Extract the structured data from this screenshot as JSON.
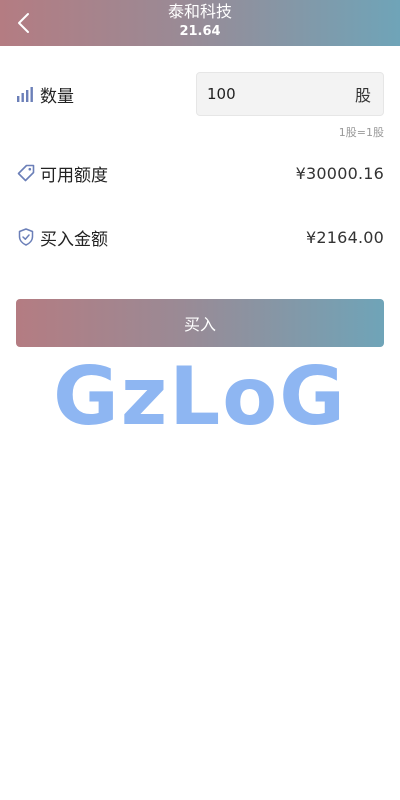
{
  "header": {
    "title": "泰和科技",
    "price": "21.64"
  },
  "quantity": {
    "label": "数量",
    "value": "100",
    "unit": "股",
    "hint": "1股=1股"
  },
  "available": {
    "label": "可用额度",
    "value": "¥30000.16"
  },
  "amount": {
    "label": "买入金额",
    "value": "¥2164.00"
  },
  "buy_button": {
    "label": "买入"
  },
  "watermark": {
    "text": "GzLoG"
  },
  "colors": {
    "gradient_start": "#b47c82",
    "gradient_end": "#6fa4b8",
    "icon": "#6b7fb8",
    "watermark": "#8eb6f2"
  },
  "icons": {
    "back": "chevron-left-icon",
    "quantity": "signal-bars-icon",
    "available": "tag-icon",
    "amount": "shield-icon"
  }
}
